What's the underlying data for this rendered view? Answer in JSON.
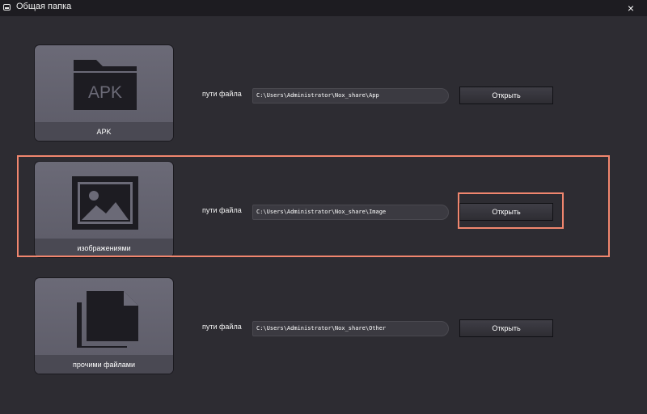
{
  "window": {
    "title": "Общая папка",
    "close_glyph": "×"
  },
  "rows": [
    {
      "tile_label": "APK",
      "icon": "apk-folder-icon",
      "icon_text": "APK",
      "path_label": "пути файла",
      "path": "C:\\Users\\Administrator\\Nox_share\\App",
      "button": "Открыть"
    },
    {
      "tile_label": "изображениями",
      "icon": "image-icon",
      "path_label": "пути файла",
      "path": "C:\\Users\\Administrator\\Nox_share\\Image",
      "button": "Открыть"
    },
    {
      "tile_label": "прочими файлами",
      "icon": "documents-icon",
      "path_label": "пути файла",
      "path": "C:\\Users\\Administrator\\Nox_share\\Other",
      "button": "Открыть"
    }
  ],
  "colors": {
    "background": "#2d2c32",
    "titlebar": "#1d1c21",
    "tile": "#6b6a77",
    "highlight": "#f0866e"
  }
}
